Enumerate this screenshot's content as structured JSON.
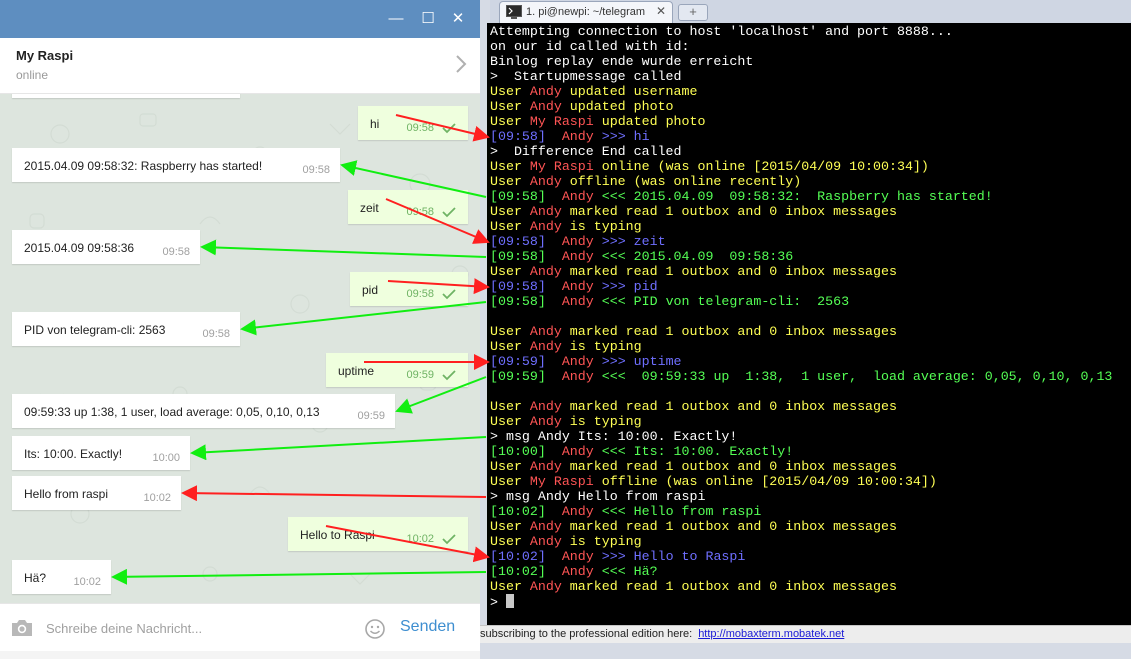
{
  "telegram": {
    "window_controls": [
      "—",
      "☐",
      "✕"
    ],
    "chat_title": "My Raspi",
    "chat_status": "online",
    "input_placeholder": "Schreibe deine Nachricht...",
    "send_label": "Senden",
    "icons": {
      "camera": "camera-icon",
      "emoji": "emoji-icon",
      "chevron": "chevron-right-icon"
    },
    "colors": {
      "titlebar": "#5e8ec0",
      "outgoing": "#efffde",
      "incoming": "#ffffff",
      "send": "#3e8ed0"
    },
    "messages": [
      {
        "dir": "out",
        "text": "hi",
        "time": "09:58",
        "read": true
      },
      {
        "dir": "in",
        "text": "2015.04.09 09:58:32: Raspberry has started!",
        "time": "09:58"
      },
      {
        "dir": "out",
        "text": "zeit",
        "time": "09:58",
        "read": true
      },
      {
        "dir": "in",
        "text": "2015.04.09 09:58:36",
        "time": "09:58"
      },
      {
        "dir": "out",
        "text": "pid",
        "time": "09:58",
        "read": true
      },
      {
        "dir": "in",
        "text": "PID von telegram-cli: 2563",
        "time": "09:58"
      },
      {
        "dir": "out",
        "text": "uptime",
        "time": "09:59",
        "read": true
      },
      {
        "dir": "in",
        "text": "09:59:33 up 1:38, 1 user, load average: 0,05, 0,10, 0,13",
        "time": "09:59"
      },
      {
        "dir": "in",
        "text": "Its: 10:00. Exactly!",
        "time": "10:00"
      },
      {
        "dir": "in",
        "text": "Hello from raspi",
        "time": "10:02"
      },
      {
        "dir": "out",
        "text": "Hello to Raspi",
        "time": "10:02",
        "read": true
      },
      {
        "dir": "in",
        "text": "Hä?",
        "time": "10:02"
      }
    ]
  },
  "terminal": {
    "tab_title": "1. pi@newpi: ~/telegram",
    "new_tab": "+",
    "tab_close": "✕",
    "status_text": "subscribing to the professional edition here:",
    "status_link": "http://mobaxterm.mobatek.net",
    "colors": {
      "white": "#ffffff",
      "yellow": "#ffff55",
      "red": "#ff5555",
      "blue": "#6f6fff",
      "green": "#55ff55"
    },
    "lines": [
      [
        [
          "Attempting connection to host 'localhost' and port 8888...",
          "white"
        ]
      ],
      [
        [
          "on our id called with id:",
          "white"
        ]
      ],
      [
        [
          "Binlog replay ende wurde erreicht",
          "white"
        ]
      ],
      [
        [
          ">  Startupmessage called",
          "white"
        ]
      ],
      [
        [
          "User ",
          "yellow"
        ],
        [
          "Andy",
          "red"
        ],
        [
          " updated username",
          "yellow"
        ]
      ],
      [
        [
          "User ",
          "yellow"
        ],
        [
          "Andy",
          "red"
        ],
        [
          " updated photo",
          "yellow"
        ]
      ],
      [
        [
          "User ",
          "yellow"
        ],
        [
          "My Raspi",
          "red"
        ],
        [
          " updated photo",
          "yellow"
        ]
      ],
      [
        [
          "[09:58]",
          "blue"
        ],
        [
          "  Andy",
          "red"
        ],
        [
          " >>> hi",
          "blue"
        ]
      ],
      [
        [
          ">  Difference End called",
          "white"
        ]
      ],
      [
        [
          "User ",
          "yellow"
        ],
        [
          "My Raspi",
          "red"
        ],
        [
          " online (was online [2015/04/09 10:00:34])",
          "yellow"
        ]
      ],
      [
        [
          "User ",
          "yellow"
        ],
        [
          "Andy",
          "red"
        ],
        [
          " offline (was online recently)",
          "yellow"
        ]
      ],
      [
        [
          "[09:58]",
          "green"
        ],
        [
          "  Andy",
          "red"
        ],
        [
          " <<< 2015.04.09  09:58:32:  Raspberry has started!",
          "green"
        ]
      ],
      [
        [
          "User ",
          "yellow"
        ],
        [
          "Andy",
          "red"
        ],
        [
          " marked read 1 outbox and 0 inbox messages",
          "yellow"
        ]
      ],
      [
        [
          "User ",
          "yellow"
        ],
        [
          "Andy",
          "red"
        ],
        [
          " is typing",
          "yellow"
        ]
      ],
      [
        [
          "[09:58]",
          "blue"
        ],
        [
          "  Andy",
          "red"
        ],
        [
          " >>> zeit",
          "blue"
        ]
      ],
      [
        [
          "[09:58]",
          "green"
        ],
        [
          "  Andy",
          "red"
        ],
        [
          " <<< 2015.04.09  09:58:36",
          "green"
        ]
      ],
      [
        [
          "User ",
          "yellow"
        ],
        [
          "Andy",
          "red"
        ],
        [
          " marked read 1 outbox and 0 inbox messages",
          "yellow"
        ]
      ],
      [
        [
          "[09:58]",
          "blue"
        ],
        [
          "  Andy",
          "red"
        ],
        [
          " >>> pid",
          "blue"
        ]
      ],
      [
        [
          "[09:58]",
          "green"
        ],
        [
          "  Andy",
          "red"
        ],
        [
          " <<< PID von telegram-cli:  2563",
          "green"
        ]
      ],
      [],
      [
        [
          "User ",
          "yellow"
        ],
        [
          "Andy",
          "red"
        ],
        [
          " marked read 1 outbox and 0 inbox messages",
          "yellow"
        ]
      ],
      [
        [
          "User ",
          "yellow"
        ],
        [
          "Andy",
          "red"
        ],
        [
          " is typing",
          "yellow"
        ]
      ],
      [
        [
          "[09:59]",
          "blue"
        ],
        [
          "  Andy",
          "red"
        ],
        [
          " >>> uptime",
          "blue"
        ]
      ],
      [
        [
          "[09:59]",
          "green"
        ],
        [
          "  Andy",
          "red"
        ],
        [
          " <<<  09:59:33 up  1:38,  1 user,  load average: 0,05, 0,10, 0,13",
          "green"
        ]
      ],
      [],
      [
        [
          "User ",
          "yellow"
        ],
        [
          "Andy",
          "red"
        ],
        [
          " marked read 1 outbox and 0 inbox messages",
          "yellow"
        ]
      ],
      [
        [
          "User ",
          "yellow"
        ],
        [
          "Andy",
          "red"
        ],
        [
          " is typing",
          "yellow"
        ]
      ],
      [
        [
          "> msg Andy Its: 10:00. Exactly!",
          "white"
        ]
      ],
      [
        [
          "[10:00]",
          "green"
        ],
        [
          "  Andy",
          "red"
        ],
        [
          " <<< Its: 10:00. Exactly!",
          "green"
        ]
      ],
      [
        [
          "User ",
          "yellow"
        ],
        [
          "Andy",
          "red"
        ],
        [
          " marked read 1 outbox and 0 inbox messages",
          "yellow"
        ]
      ],
      [
        [
          "User ",
          "yellow"
        ],
        [
          "My Raspi",
          "red"
        ],
        [
          " offline (was online [2015/04/09 10:00:34])",
          "yellow"
        ]
      ],
      [
        [
          "> msg Andy Hello from raspi",
          "white"
        ]
      ],
      [
        [
          "[10:02]",
          "green"
        ],
        [
          "  Andy",
          "red"
        ],
        [
          " <<< Hello from raspi",
          "green"
        ]
      ],
      [
        [
          "User ",
          "yellow"
        ],
        [
          "Andy",
          "red"
        ],
        [
          " marked read 1 outbox and 0 inbox messages",
          "yellow"
        ]
      ],
      [
        [
          "User ",
          "yellow"
        ],
        [
          "Andy",
          "red"
        ],
        [
          " is typing",
          "yellow"
        ]
      ],
      [
        [
          "[10:02]",
          "blue"
        ],
        [
          "  Andy",
          "red"
        ],
        [
          " >>> Hello to Raspi",
          "blue"
        ]
      ],
      [
        [
          "[10:02]",
          "green"
        ],
        [
          "  Andy",
          "red"
        ],
        [
          " <<< Hä?",
          "green"
        ]
      ],
      [
        [
          "User ",
          "yellow"
        ],
        [
          "Andy",
          "red"
        ],
        [
          " marked read 1 outbox and 0 inbox messages",
          "yellow"
        ]
      ],
      [
        [
          "> ",
          "white"
        ]
      ]
    ]
  },
  "annotations": {
    "colors": {
      "sent": "#ff2020",
      "received": "#11ee11"
    },
    "arrows": [
      {
        "kind": "sent",
        "bubble": 0,
        "line": 7
      },
      {
        "kind": "received",
        "bubble": 1,
        "line": 11
      },
      {
        "kind": "sent",
        "bubble": 2,
        "line": 14
      },
      {
        "kind": "received",
        "bubble": 3,
        "line": 15
      },
      {
        "kind": "sent",
        "bubble": 4,
        "line": 17
      },
      {
        "kind": "received",
        "bubble": 5,
        "line": 18
      },
      {
        "kind": "sent",
        "bubble": 6,
        "line": 22
      },
      {
        "kind": "received",
        "bubble": 7,
        "line": 23
      },
      {
        "kind": "received",
        "bubble": 8,
        "line": 27
      },
      {
        "kind": "sent",
        "bubble": 9,
        "line": 31
      },
      {
        "kind": "sent",
        "bubble": 10,
        "line": 35
      },
      {
        "kind": "received",
        "bubble": 11,
        "line": 36
      }
    ]
  }
}
